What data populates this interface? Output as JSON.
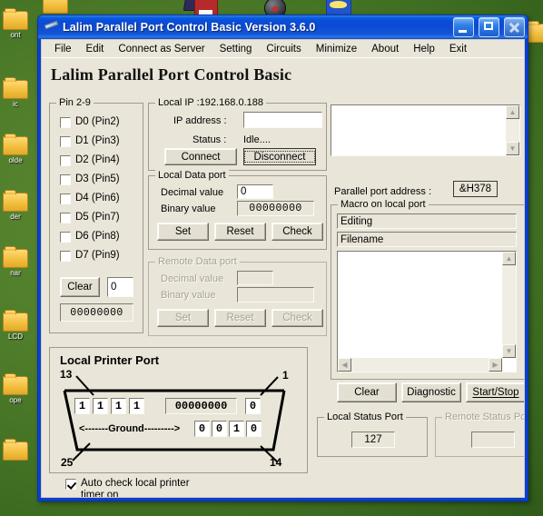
{
  "desktop": {
    "icons": [
      {
        "label": "",
        "type": "folder"
      },
      {
        "label": "ont",
        "type": "folder"
      },
      {
        "label": "ic",
        "type": "folder"
      },
      {
        "label": "olde",
        "type": "folder"
      },
      {
        "label": "der",
        "type": "folder"
      },
      {
        "label": "nar",
        "type": "folder"
      },
      {
        "label": "LCD",
        "type": "folder"
      },
      {
        "label": "ope",
        "type": "folder"
      },
      {
        "label": "",
        "type": "folder-top"
      },
      {
        "label": "",
        "type": "red"
      },
      {
        "label": "",
        "type": "dial"
      },
      {
        "label": "",
        "type": "blue"
      },
      {
        "label": "",
        "type": "dark"
      },
      {
        "label": "",
        "type": "folder-right"
      }
    ]
  },
  "window": {
    "title": "Lalim Parallel Port Control  Basic    Version 3.6.0",
    "app_icon": "pen-icon",
    "buttons": {
      "minimize": "minimize-icon",
      "maximize": "maximize-icon",
      "close": "close-icon"
    },
    "accent_color": "#0a4fd8",
    "face_color": "#e9e5d8"
  },
  "menu": {
    "items": [
      "File",
      "Edit",
      "Connect as Server",
      "Setting",
      "Circuits",
      "Minimize",
      "About",
      "Help",
      "Exit"
    ]
  },
  "heading": "Lalim Parallel Port Control Basic",
  "pin_group": {
    "title": "Pin 2-9",
    "pins": [
      {
        "label": "D0  (Pin2)",
        "checked": false
      },
      {
        "label": "D1  (Pin3)",
        "checked": false
      },
      {
        "label": "D2  (Pin4)",
        "checked": false
      },
      {
        "label": "D3  (Pin5)",
        "checked": false
      },
      {
        "label": "D4  (Pin6)",
        "checked": false
      },
      {
        "label": "D5  (Pin7)",
        "checked": false
      },
      {
        "label": "D6  (Pin8)",
        "checked": false
      },
      {
        "label": "D7  (Pin9)",
        "checked": false
      }
    ],
    "clear_button": "Clear",
    "decimal_value": "0",
    "binary_value": "00000000"
  },
  "local_ip": {
    "title": "Local IP   :192.168.0.188",
    "ip_label": "IP address :",
    "ip_value": "",
    "status_label": "Status :",
    "status_value": "Idle....",
    "connect_button": "Connect",
    "disconnect_button": "Disconnect",
    "disconnect_focused": true
  },
  "local_data_port": {
    "title": "Local Data port",
    "decimal_label": "Decimal value",
    "decimal_value": "0",
    "binary_label": "Binary value",
    "binary_value": "00000000",
    "set_button": "Set",
    "reset_button": "Reset",
    "check_button": "Check",
    "enabled": true
  },
  "remote_data_port": {
    "title": "Remote Data port",
    "decimal_label": "Decimal value",
    "decimal_value": "",
    "binary_label": "Binary value",
    "binary_value": "",
    "set_button": "Set",
    "reset_button": "Reset",
    "check_button": "Check",
    "enabled": false
  },
  "log_box": {
    "value": "",
    "scroll_up": "scroll-up-icon",
    "scroll_down": "scroll-down-icon"
  },
  "parallel_port": {
    "label": "Parallel port address  :",
    "address": "&H378"
  },
  "macro": {
    "title": "Macro on local port",
    "editing_value": "Editing",
    "filename_value": "Filename",
    "content": "",
    "clear_button": "Clear",
    "diagnostic_button": "Diagnostic",
    "startstop_button": "Start/Stop",
    "startstop_accel": "S"
  },
  "printer_port": {
    "title": "Local Printer Port",
    "pin13": "13",
    "pin1": "1",
    "pin25": "25",
    "pin14": "14",
    "top_bits": [
      "1",
      "1",
      "1",
      "1"
    ],
    "data_bits": "00000000",
    "top_right_bit": "0",
    "bottom_bits": [
      "0",
      "0",
      "1",
      "0"
    ],
    "ground_label": "<-------Ground--------->"
  },
  "local_status_port": {
    "title": "Local Status Port",
    "value": "127",
    "enabled": true
  },
  "remote_status_port": {
    "title": "Remote Status Port",
    "value": "",
    "enabled": false
  },
  "auto_check": {
    "line1": "Auto check local printer",
    "line2": "timer on",
    "checked": true
  }
}
